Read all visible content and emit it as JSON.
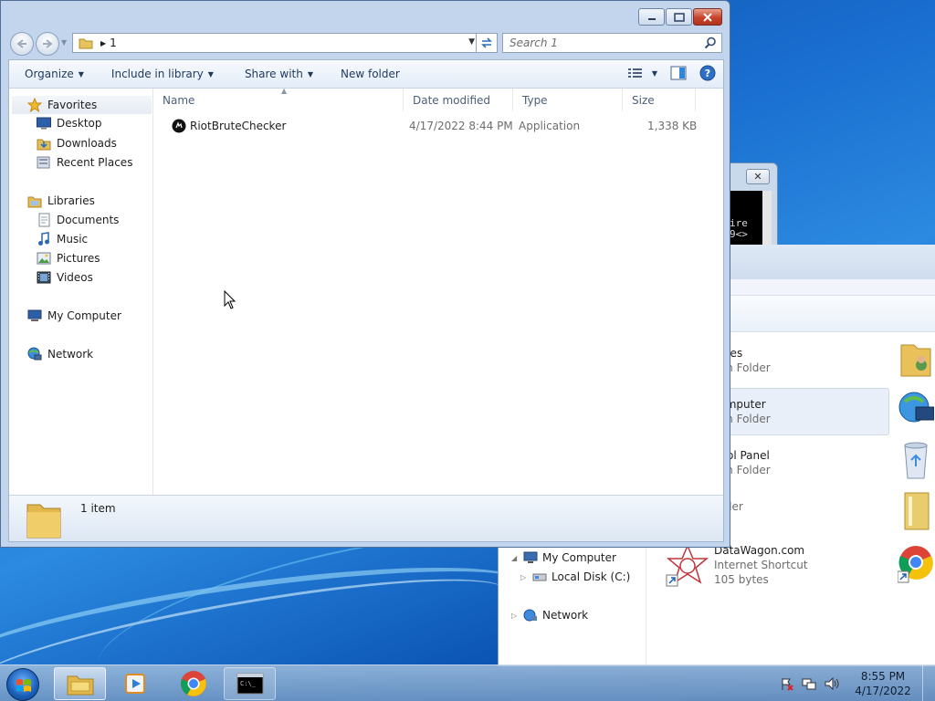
{
  "explorer": {
    "address": {
      "segment": "1"
    },
    "search": {
      "placeholder": "Search 1"
    },
    "toolbar": {
      "organize": "Organize",
      "include_in_library": "Include in library",
      "share_with": "Share with",
      "new_folder": "New folder"
    },
    "nav_pane": {
      "favorites": "Favorites",
      "favorites_items": [
        "Desktop",
        "Downloads",
        "Recent Places"
      ],
      "libraries": "Libraries",
      "libraries_items": [
        "Documents",
        "Music",
        "Pictures",
        "Videos"
      ],
      "my_computer": "My Computer",
      "network": "Network"
    },
    "columns": {
      "name": "Name",
      "date_modified": "Date modified",
      "type": "Type",
      "size": "Size"
    },
    "files": [
      {
        "name": "RiotBruteChecker",
        "date_modified": "4/17/2022 8:44 PM",
        "type": "Application",
        "size": "1,338 KB"
      }
    ],
    "details": {
      "count": "1 item"
    }
  },
  "background_explorer": {
    "nav": {
      "my_computer": "My Computer",
      "local_disk": "Local Disk (C:)",
      "network": "Network"
    },
    "items": [
      {
        "title": "raries",
        "subtitle": "tem Folder"
      },
      {
        "title": "Computer",
        "subtitle": "tem Folder"
      },
      {
        "title": "ntrol Panel",
        "subtitle": "tem Folder"
      },
      {
        "title": "",
        "subtitle": "folder"
      },
      {
        "title": "DataWagon.com",
        "subtitle": "Internet Shortcut",
        "extra": "105 bytes"
      }
    ]
  },
  "background_console": {
    "text": "ire\n9<>"
  },
  "taskbar": {
    "time": "8:55 PM",
    "date": "4/17/2022"
  },
  "colors": {
    "accent": "#1e395b",
    "selection": "#e8eff8"
  }
}
